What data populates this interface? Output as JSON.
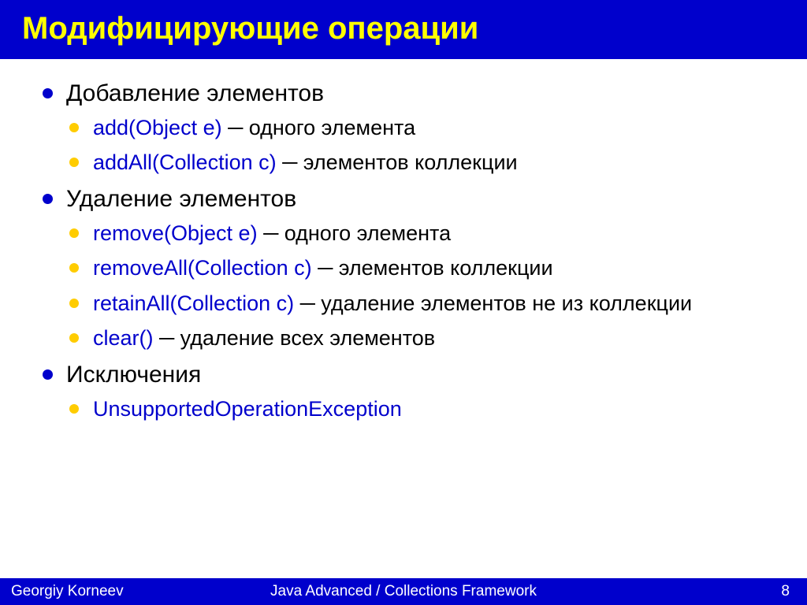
{
  "title": "Модифицирующие операции",
  "sections": [
    {
      "heading": "Добавление элементов",
      "items": [
        {
          "code": "add(Object e)",
          "desc": " ─ одного элемента"
        },
        {
          "code": "addAll(Collection c)",
          "desc": " ─ элементов коллекции"
        }
      ]
    },
    {
      "heading": "Удаление элементов",
      "items": [
        {
          "code": "remove(Object e)",
          "desc": " ─ одного элемента"
        },
        {
          "code": "removeAll(Collection c)",
          "desc": " ─ элементов коллекции"
        },
        {
          "code": "retainAll(Collection c)",
          "desc": " ─ удаление элементов не из коллекции"
        },
        {
          "code": "clear()",
          "desc": " ─ удаление всех элементов"
        }
      ]
    },
    {
      "heading": "Исключения",
      "items": [
        {
          "code": "UnsupportedOperationException",
          "desc": ""
        }
      ]
    }
  ],
  "footer": {
    "author": "Georgiy Korneev",
    "course": "Java Advanced / Collections Framework",
    "page": "8"
  }
}
